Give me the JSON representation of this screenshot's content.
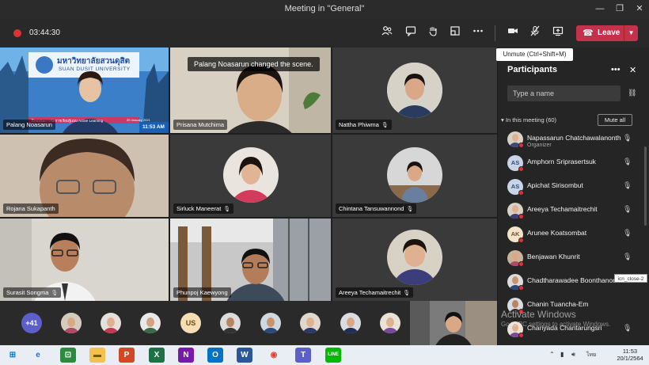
{
  "window": {
    "title": "Meeting in \"General\"",
    "min": "—",
    "max": "❐",
    "close": "✕"
  },
  "toolbar": {
    "timer": "03:44:30",
    "leave_label": "Leave",
    "tooltip": "Unmute (Ctrl+Shift+M)"
  },
  "scene_banner": "Palang Noasarun changed the scene.",
  "tiles": [
    {
      "name": "Palang Noasarun",
      "university_thai": "มหาวิทยาลัยสวนดุสิต",
      "university_en": "SUAN DUSIT UNIVERSITY",
      "time": "11:53 AM",
      "date": "20 January 2021",
      "subtitle": "ฝึกอบรมการจัดการเรียนรู้แบบ Active Learning"
    },
    {
      "name": "Prisana Mutchima"
    },
    {
      "name": "Nattha Phiwma"
    },
    {
      "name": "Rojana Sukapanth"
    },
    {
      "name": "Sirluck Maneerat"
    },
    {
      "name": "Chintana Tansuwannond"
    },
    {
      "name": "Surasit Songma"
    },
    {
      "name": "Phunpoj Kaewyong"
    },
    {
      "name": "Areeya Techamaitrechit"
    }
  ],
  "strip": {
    "more_count": "+41",
    "initials": "US"
  },
  "panel": {
    "title": "Participants",
    "more": "•••",
    "close": "✕",
    "search_placeholder": "Type a name",
    "section_label": "In this meeting (60)",
    "mute_all": "Mute all",
    "organizer_label": "Organizer",
    "participants": [
      {
        "name": "Napassarun Chatchawalanonth",
        "initials": ""
      },
      {
        "name": "Amphorn Sriprasertsuk",
        "initials": "AS"
      },
      {
        "name": "Apichat Sirisombut",
        "initials": "AS"
      },
      {
        "name": "Areeya Techamaitrechit",
        "initials": ""
      },
      {
        "name": "Arunee Koatsombat",
        "initials": "AK"
      },
      {
        "name": "Benjawan Khunrit",
        "initials": ""
      },
      {
        "name": "Chadtharawadee Boonthanom",
        "initials": ""
      },
      {
        "name": "Chanin Tuancha-Em",
        "initials": ""
      },
      {
        "name": "Chariyada Chantarungsri",
        "initials": ""
      }
    ],
    "close_tip": "icn_close-2"
  },
  "watermark": {
    "line1": "Activate Windows",
    "line2": "Go to PC settings to activate Windows."
  },
  "taskbar": {
    "time": "11:53",
    "date": "20/1/2564",
    "lang": "ไทย"
  }
}
